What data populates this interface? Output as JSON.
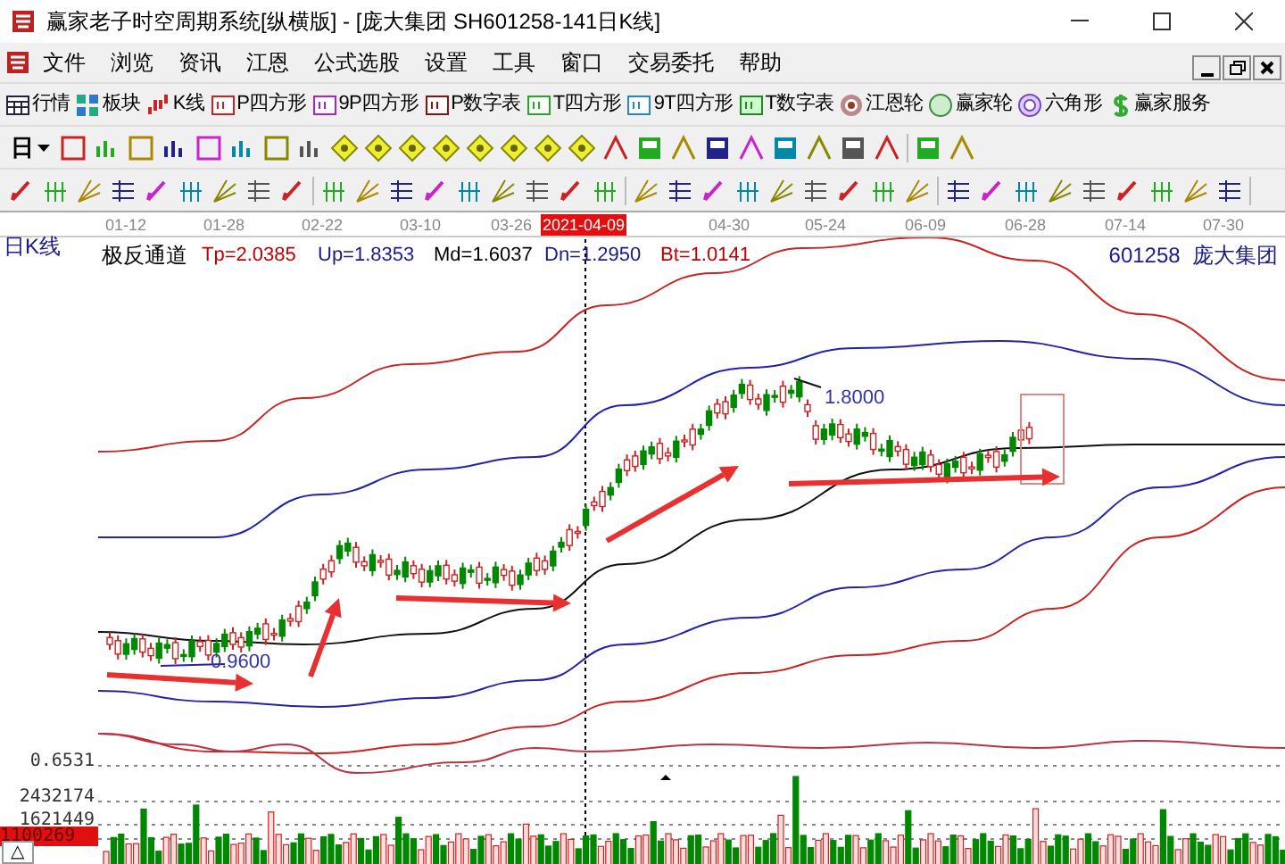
{
  "window": {
    "title": "赢家老子时空周期系统[纵横版] - [庞大集团  SH601258-141日K线]"
  },
  "menu": [
    "文件",
    "浏览",
    "资讯",
    "江恩",
    "公式选股",
    "设置",
    "工具",
    "窗口",
    "交易委托",
    "帮助"
  ],
  "toolbar": [
    {
      "label": "行情",
      "kind": "table"
    },
    {
      "label": "板块",
      "kind": "blocks"
    },
    {
      "label": "K线",
      "kind": "kline"
    },
    {
      "label": "P四方形",
      "kind": "PS"
    },
    {
      "label": "9P四方形",
      "kind": "P9"
    },
    {
      "label": "P数字表",
      "kind": "PN"
    },
    {
      "label": "T四方形",
      "kind": "TS"
    },
    {
      "label": "9T四方形",
      "kind": "T9"
    },
    {
      "label": "T数字表",
      "kind": "TN"
    },
    {
      "label": "江恩轮",
      "kind": "wheel"
    },
    {
      "label": "赢家轮",
      "kind": "wheel2"
    },
    {
      "label": "六角形",
      "kind": "hex"
    },
    {
      "label": "赢家服务",
      "kind": "dollar"
    }
  ],
  "period": {
    "value": "日"
  },
  "chart": {
    "label": "日K线",
    "dates": [
      {
        "text": "01-12",
        "highlighted": false
      },
      {
        "text": "01-28",
        "highlighted": false
      },
      {
        "text": "02-22",
        "highlighted": false
      },
      {
        "text": "03-10",
        "highlighted": false
      },
      {
        "text": "03-26",
        "highlighted": false
      },
      {
        "text": "2021-04-09",
        "highlighted": true
      },
      {
        "text": "04-30",
        "highlighted": false
      },
      {
        "text": "05-24",
        "highlighted": false
      },
      {
        "text": "06-09",
        "highlighted": false
      },
      {
        "text": "06-28",
        "highlighted": false
      },
      {
        "text": "07-14",
        "highlighted": false
      },
      {
        "text": "07-30",
        "highlighted": false
      }
    ],
    "indicator": "极反通道",
    "values": [
      {
        "text": "Tp=2.0385",
        "color": "#c00000"
      },
      {
        "text": "Up=1.8353",
        "color": "#1a1a8c"
      },
      {
        "text": "Md=1.6037",
        "color": "#000000"
      },
      {
        "text": "Dn=1.2950",
        "color": "#1a1a8c"
      },
      {
        "text": "Bt=1.0141",
        "color": "#c00000"
      }
    ],
    "stock": "601258  庞大集团",
    "annotations": [
      "0.9600",
      "1.8000"
    ],
    "lower_labels": [
      {
        "text": "0.6531",
        "highlighted": false
      },
      {
        "text": "2432174",
        "highlighted": false
      },
      {
        "text": "1621449",
        "highlighted": false
      },
      {
        "text": "1100269",
        "highlighted": true
      }
    ],
    "corner_button": "△"
  }
}
